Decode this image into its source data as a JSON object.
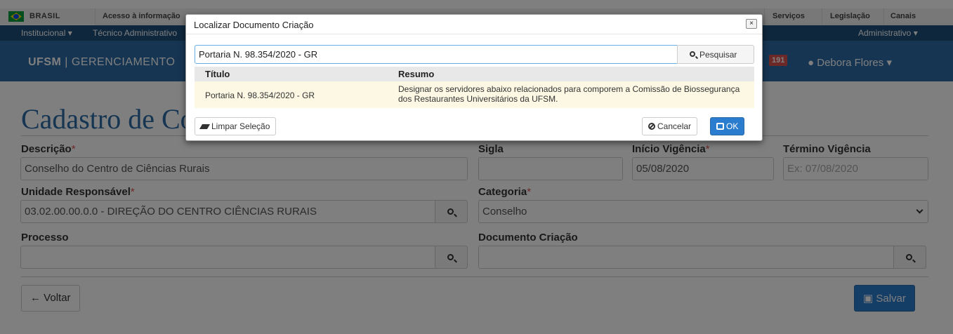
{
  "govbar": {
    "country": "BRASIL",
    "links": [
      "Acesso à informação",
      "Serviços",
      "Legislação",
      "Canais"
    ]
  },
  "sysbar": {
    "left_items": [
      "Institucional ▾",
      "Técnico Administrativo"
    ],
    "right_item": "Administrativo ▾"
  },
  "header": {
    "brand_bold": "UFSM",
    "brand_rest": " | GERENCIAMENTO",
    "badge": "191",
    "user": "Debora Flores ▾"
  },
  "page": {
    "title": "Cadastro de Co",
    "fields": {
      "descricao_label": "Descrição",
      "descricao_value": "Conselho do Centro de Ciências Rurais",
      "sigla_label": "Sigla",
      "sigla_value": "",
      "inicio_label": "Início Vigência",
      "inicio_value": "05/08/2020",
      "termino_label": "Término Vigência",
      "termino_placeholder": "Ex: 07/08/2020",
      "unidade_label": "Unidade Responsável",
      "unidade_value": "03.02.00.00.0.0 - DIREÇÃO DO CENTRO CIÊNCIAS RURAIS",
      "categoria_label": "Categoria",
      "categoria_value": "Conselho",
      "processo_label": "Processo",
      "processo_value": "",
      "documento_label": "Documento Criação",
      "documento_value": ""
    },
    "required_mark": "*",
    "back_label": "Voltar",
    "save_label": "Salvar"
  },
  "modal": {
    "title": "Localizar Documento Criação",
    "close": "×",
    "search_value": "Portaria N. 98.354/2020 - GR",
    "search_button": "Pesquisar",
    "columns": [
      "Título",
      "Resumo"
    ],
    "rows": [
      {
        "titulo": "Portaria N. 98.354/2020 - GR",
        "resumo": "Designar os servidores abaixo relacionados para comporem a Comissão de Biossegurança dos Restaurantes Universitários da UFSM."
      }
    ],
    "clear_button": "Limpar Seleção",
    "cancel_button": "Cancelar",
    "ok_button": "OK"
  },
  "colors": {
    "header_blue": "#2a6aa4",
    "sysbar_blue": "#1e4f7b",
    "primary": "#2a7ccf",
    "selected_row": "#fcf8e3",
    "badge_red": "#d9534f"
  }
}
